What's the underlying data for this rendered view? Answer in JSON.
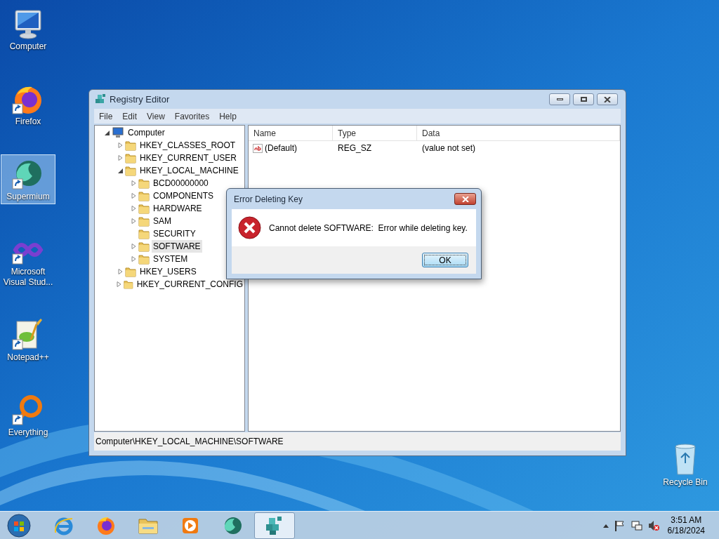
{
  "desktop_icons": [
    {
      "kind": "computer",
      "label": "Computer",
      "selected": false
    },
    {
      "kind": "firefox",
      "label": "Firefox",
      "selected": false
    },
    {
      "kind": "supermium",
      "label": "Supermium",
      "selected": true
    },
    {
      "kind": "vs",
      "label": "Microsoft Visual Stud...",
      "selected": false
    },
    {
      "kind": "notepad",
      "label": "Notepad++",
      "selected": false
    },
    {
      "kind": "everything",
      "label": "Everything",
      "selected": false
    }
  ],
  "recycle_bin": {
    "label": "Recycle Bin"
  },
  "registry_editor": {
    "title": "Registry Editor",
    "menu": [
      "File",
      "Edit",
      "View",
      "Favorites",
      "Help"
    ],
    "tree": [
      {
        "label": "Computer",
        "kind": "computer",
        "expandable": true,
        "selected": false,
        "children": [
          {
            "label": "HKEY_CLASSES_ROOT",
            "kind": "folder",
            "expandable": true,
            "selected": false
          },
          {
            "label": "HKEY_CURRENT_USER",
            "kind": "folder",
            "expandable": true,
            "selected": false
          },
          {
            "label": "HKEY_LOCAL_MACHINE",
            "kind": "folder",
            "expandable": true,
            "selected": false,
            "children": [
              {
                "label": "BCD00000000",
                "kind": "folder",
                "expandable": true,
                "selected": false
              },
              {
                "label": "COMPONENTS",
                "kind": "folder",
                "expandable": true,
                "selected": false
              },
              {
                "label": "HARDWARE",
                "kind": "folder",
                "expandable": true,
                "selected": false
              },
              {
                "label": "SAM",
                "kind": "folder",
                "expandable": true,
                "selected": false
              },
              {
                "label": "SECURITY",
                "kind": "folder",
                "expandable": false,
                "selected": false
              },
              {
                "label": "SOFTWARE",
                "kind": "folder",
                "expandable": true,
                "selected": true
              },
              {
                "label": "SYSTEM",
                "kind": "folder",
                "expandable": true,
                "selected": false
              }
            ]
          },
          {
            "label": "HKEY_USERS",
            "kind": "folder",
            "expandable": true,
            "selected": false
          },
          {
            "label": "HKEY_CURRENT_CONFIG",
            "kind": "folder",
            "expandable": true,
            "selected": false
          }
        ]
      }
    ],
    "columns": [
      "Name",
      "Type",
      "Data"
    ],
    "values": [
      {
        "name": "(Default)",
        "type": "REG_SZ",
        "data": "(value not set)"
      }
    ],
    "status_bar": "Computer\\HKEY_LOCAL_MACHINE\\SOFTWARE"
  },
  "dialog": {
    "title": "Error Deleting Key",
    "message": "Cannot delete SOFTWARE:  Error while deleting key.",
    "button": "OK"
  },
  "taskbar": {
    "apps": [
      {
        "kind": "ie",
        "active": false
      },
      {
        "kind": "firefox",
        "active": false
      },
      {
        "kind": "explorer",
        "active": false
      },
      {
        "kind": "media",
        "active": false
      },
      {
        "kind": "supermium",
        "active": false
      },
      {
        "kind": "regedit",
        "active": true
      }
    ],
    "clock": {
      "time": "3:51 AM",
      "date": "6/18/2024"
    }
  }
}
